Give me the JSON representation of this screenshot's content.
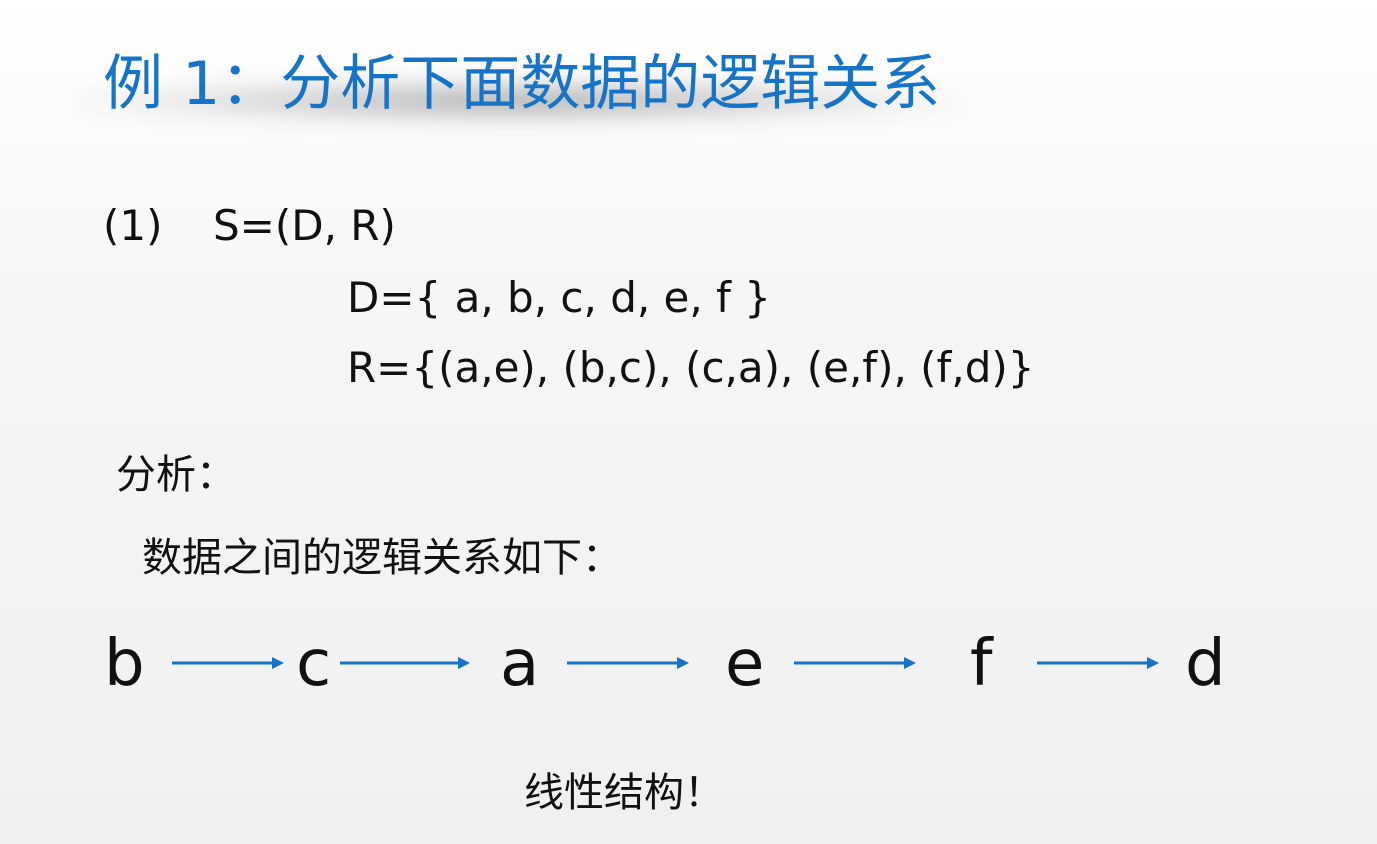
{
  "slide": {
    "title": "例 1：分析下面数据的逻辑关系",
    "structure": {
      "index": "(1)",
      "expression": "S=(D, R)"
    },
    "data_set": "D={ a, b, c, d, e, f }",
    "relation_set": "R={(a,e), (b,c), (c,a), (e,f), (f,d)}",
    "analysis_label": "分析：",
    "relation_note": "数据之间的逻辑关系如下：",
    "chain": [
      "b",
      "c",
      "a",
      "e",
      "f",
      "d"
    ],
    "conclusion": "线性结构！",
    "arrow_color": "#1574c8",
    "title_color": "#1574c8"
  }
}
